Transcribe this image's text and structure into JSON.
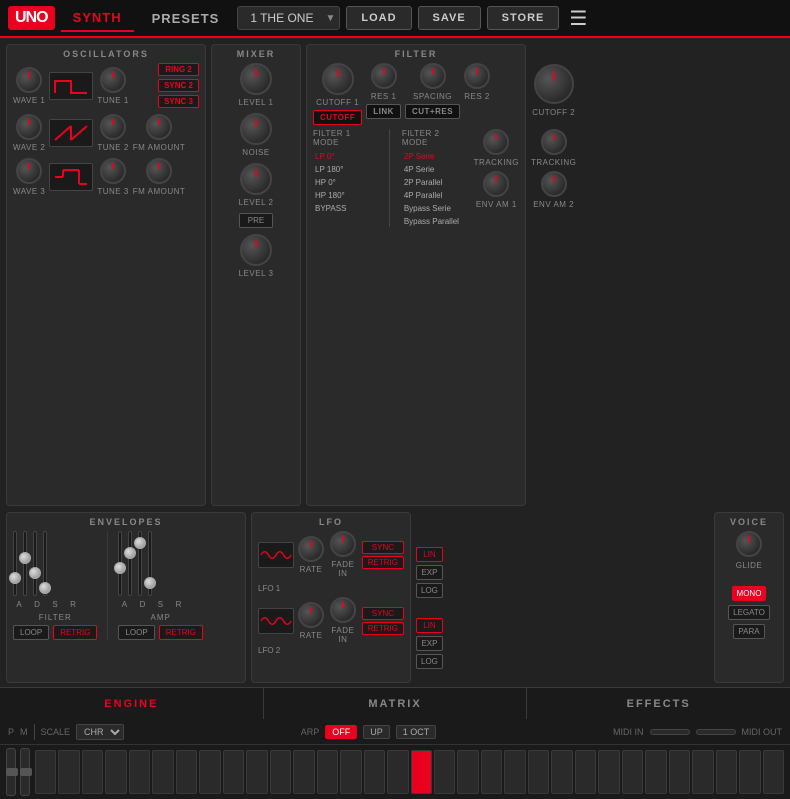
{
  "app": {
    "logo": "UNO",
    "tabs": [
      "SYNTH",
      "PRESETS"
    ],
    "active_tab": "SYNTH",
    "preset_name": "1 THE ONE",
    "buttons": [
      "LOAD",
      "SAVE",
      "STORE"
    ]
  },
  "oscillators": {
    "title": "OSCILLATORS",
    "rows": [
      {
        "label": "WAVE 1",
        "tune_label": "TUNE 1"
      },
      {
        "label": "WAVE 2",
        "tune_label": "TUNE 2",
        "fm_label": "FM AMOUNT"
      },
      {
        "label": "WAVE 3",
        "tune_label": "TUNE 3",
        "fm_label": "FM AMOUNT"
      }
    ],
    "buttons": [
      "RING 2",
      "SYNC 2",
      "SYNC 3"
    ]
  },
  "mixer": {
    "title": "MIXER",
    "knobs": [
      "LEVEL 1",
      "LEVEL 2",
      "LEVEL 3"
    ],
    "noise_label": "NOISE",
    "pre_label": "PRE"
  },
  "filter": {
    "title": "FILTER",
    "knobs_top": [
      "CUTOFF 1",
      "RES 1",
      "SPACING",
      "RES 2"
    ],
    "buttons": [
      "CUTOFF",
      "LINK",
      "CUT+RES"
    ],
    "mode1_title": "FILTER 1 MODE",
    "mode1_options": [
      "LP 0°",
      "LP 180°",
      "HP 0°",
      "HP 180°",
      "BYPASS"
    ],
    "mode2_title": "FILTER 2 MODE",
    "mode2_options": [
      "2P Serie",
      "4P Serie",
      "2P Parallel",
      "4P Parallel",
      "Bypass Serie",
      "Bypass Parallel"
    ],
    "bottom_knobs": [
      "TRACKING",
      "ENV AM 1"
    ],
    "cutoff2_label": "CUTOFF 2",
    "tracking2_label": "TRACKING",
    "envam2_label": "ENV AM 2"
  },
  "envelopes": {
    "title": "ENVELOPES",
    "filter_section": {
      "label": "FILTER",
      "adsr": [
        "A",
        "D",
        "S",
        "R"
      ],
      "buttons": [
        "LOOP",
        "RETRIG"
      ]
    },
    "amp_section": {
      "label": "AMP",
      "adsr": [
        "A",
        "D",
        "S",
        "R"
      ],
      "buttons": [
        "LOOP",
        "RETRIG"
      ]
    }
  },
  "lfo": {
    "title": "LFO",
    "lfo1": {
      "label": "LFO 1",
      "sync_btn": "SYNC",
      "retrig_btn": "RETRIG",
      "rate_label": "RATE",
      "fade_label": "FADE IN"
    },
    "lfo2": {
      "label": "LFO 2",
      "sync_btn": "SYNC",
      "retrig_btn": "RETRIG",
      "rate_label": "RATE",
      "fade_label": "FADE IN"
    },
    "mode_buttons": [
      "LIN",
      "EXP",
      "LOG"
    ]
  },
  "voice": {
    "title": "VOICE",
    "glide_label": "GLIDE",
    "buttons_top": [
      "LIN",
      "EXP",
      "LOG"
    ],
    "buttons_bottom": [
      "MONO",
      "LEGATO",
      "PARA"
    ]
  },
  "bottom_tabs": [
    "ENGINE",
    "MATRIX",
    "EFFECTS"
  ],
  "keyboard": {
    "p_label": "P",
    "m_label": "M",
    "scale_label": "SCALE",
    "scale_value": "CHR",
    "arp_label": "ARP",
    "arp_off": "OFF",
    "arp_up": "UP",
    "arp_oct": "1 OCT",
    "midi_in_label": "MIDI IN",
    "midi_out_label": "MIDI OUT"
  }
}
